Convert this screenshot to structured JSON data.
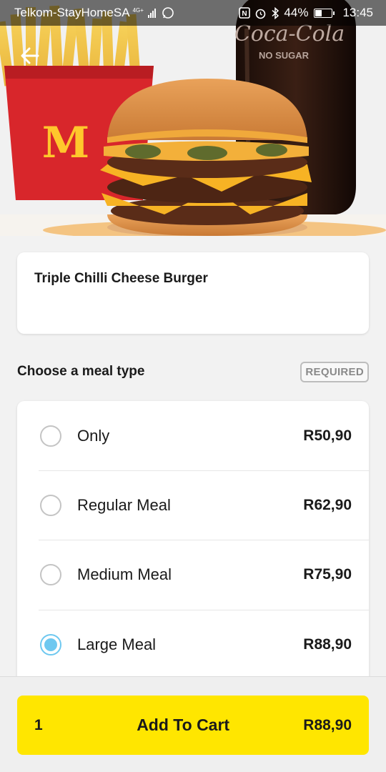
{
  "status_bar": {
    "carrier": "Telkom-StayHomeSA",
    "network_type": "4G+",
    "battery": "44%",
    "battery_level": 0.44,
    "time": "13:45"
  },
  "hero": {
    "image": "burger-meal-photo",
    "brand_text": "Coca-Cola",
    "brand_subtext": "NO SUGAR"
  },
  "product": {
    "title": "Triple Chilli Cheese Burger"
  },
  "meal_section": {
    "label": "Choose a meal type",
    "badge": "REQUIRED",
    "options": [
      {
        "name": "Only",
        "price": "R50,90",
        "selected": false
      },
      {
        "name": "Regular Meal",
        "price": "R62,90",
        "selected": false
      },
      {
        "name": "Medium Meal",
        "price": "R75,90",
        "selected": false
      },
      {
        "name": "Large Meal",
        "price": "R88,90",
        "selected": true
      }
    ]
  },
  "cart": {
    "quantity": "1",
    "label": "Add To Cart",
    "total": "R88,90"
  },
  "colors": {
    "accent_yellow": "#ffe600",
    "radio_selected": "#6ec8f0",
    "mcd_red": "#d8262b",
    "mcd_gold": "#ffc72c"
  }
}
